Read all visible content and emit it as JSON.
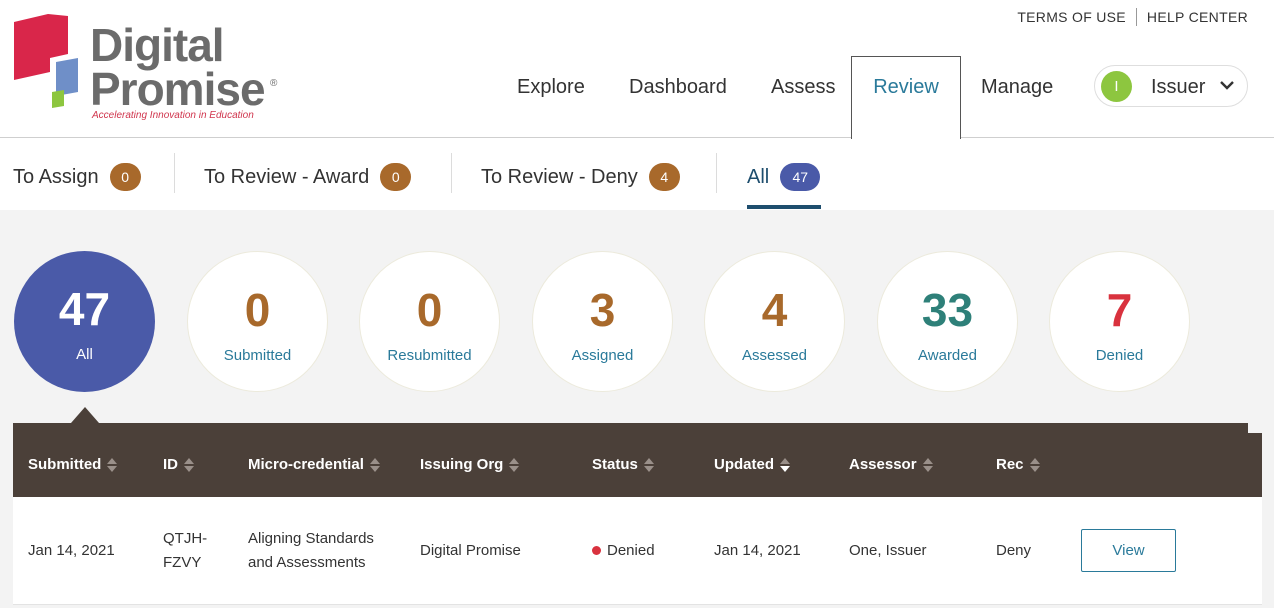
{
  "logo": {
    "word1": "Digital",
    "word2": "Promise",
    "registered": "®",
    "tagline": "Accelerating Innovation in Education",
    "colors": {
      "red": "#d9264a",
      "blue": "#6f8fc8",
      "green": "#8dc63f",
      "text": "#6b6b6b"
    }
  },
  "top_links": {
    "terms": "TERMS OF USE",
    "help": "HELP CENTER"
  },
  "nav": {
    "explore": "Explore",
    "dashboard": "Dashboard",
    "assess": "Assess",
    "review": "Review",
    "manage": "Manage",
    "active": "Review"
  },
  "user": {
    "initial": "I",
    "name": "Issuer",
    "icon": "chevron-down-icon"
  },
  "subtabs": [
    {
      "label": "To Assign",
      "count": "0"
    },
    {
      "label": "To Review - Award",
      "count": "0"
    },
    {
      "label": "To Review - Deny",
      "count": "4"
    },
    {
      "label": "All",
      "count": "47"
    }
  ],
  "stats": [
    {
      "value": "47",
      "label": "All",
      "color": "#ffffff"
    },
    {
      "value": "0",
      "label": "Submitted",
      "color": "#a8692b"
    },
    {
      "value": "0",
      "label": "Resubmitted",
      "color": "#a8692b"
    },
    {
      "value": "3",
      "label": "Assigned",
      "color": "#a8692b"
    },
    {
      "value": "4",
      "label": "Assessed",
      "color": "#a8692b"
    },
    {
      "value": "33",
      "label": "Awarded",
      "color": "#2e8079"
    },
    {
      "value": "7",
      "label": "Denied",
      "color": "#d9323e"
    }
  ],
  "table": {
    "columns": [
      "Submitted",
      "ID",
      "Micro-credential",
      "Issuing Org",
      "Status",
      "Updated",
      "Assessor",
      "Rec"
    ],
    "sorted_column": "Updated",
    "rows": [
      {
        "submitted": "Jan 14, 2021",
        "id_line1": "QTJH-",
        "id_line2": "FZVY",
        "credential_line1": "Aligning Standards",
        "credential_line2": "and Assessments",
        "org": "Digital Promise",
        "status": "Denied",
        "status_color": "#d9323e",
        "updated": "Jan 14, 2021",
        "assessor": "One, Issuer",
        "rec": "Deny",
        "action": "View"
      }
    ]
  }
}
